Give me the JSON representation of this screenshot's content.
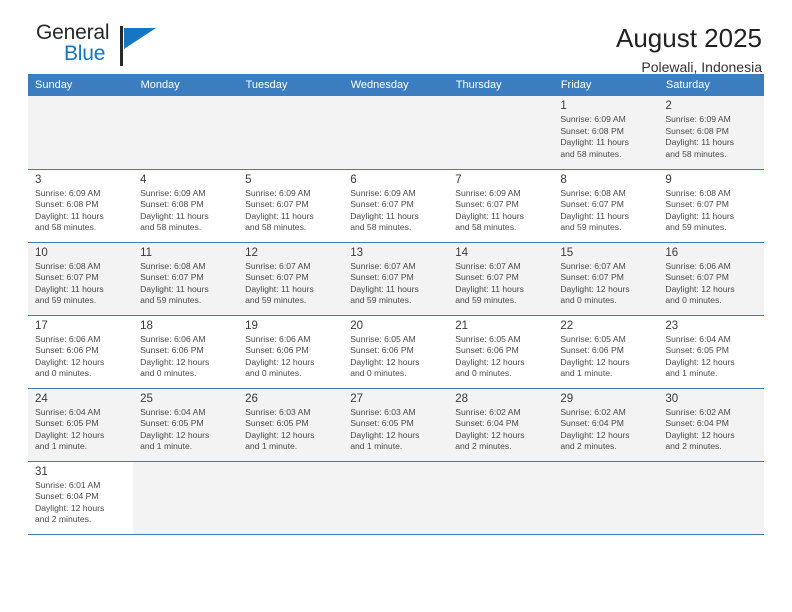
{
  "logo": {
    "word_top": "General",
    "word_bottom": "Blue",
    "triangle_color": "#1577c4",
    "icon": "general-blue-logo"
  },
  "header": {
    "title": "August 2025",
    "location": "Polewali, Indonesia"
  },
  "colors": {
    "header_row": "#3b7dbf",
    "shade_row": "#f3f3f3",
    "text": "#4a4a4a",
    "accent": "#1577c4"
  },
  "calendar": {
    "weekday_headers": [
      "Sunday",
      "Monday",
      "Tuesday",
      "Wednesday",
      "Thursday",
      "Friday",
      "Saturday"
    ],
    "labels": {
      "sunrise": "Sunrise:",
      "sunset": "Sunset:",
      "daylight": "Daylight:"
    },
    "weeks": [
      [
        {
          "day": "",
          "detail": ""
        },
        {
          "day": "",
          "detail": ""
        },
        {
          "day": "",
          "detail": ""
        },
        {
          "day": "",
          "detail": ""
        },
        {
          "day": "",
          "detail": ""
        },
        {
          "day": "1",
          "detail": "Sunrise: 6:09 AM\nSunset: 6:08 PM\nDaylight: 11 hours\nand 58 minutes."
        },
        {
          "day": "2",
          "detail": "Sunrise: 6:09 AM\nSunset: 6:08 PM\nDaylight: 11 hours\nand 58 minutes."
        }
      ],
      [
        {
          "day": "3",
          "detail": "Sunrise: 6:09 AM\nSunset: 6:08 PM\nDaylight: 11 hours\nand 58 minutes."
        },
        {
          "day": "4",
          "detail": "Sunrise: 6:09 AM\nSunset: 6:08 PM\nDaylight: 11 hours\nand 58 minutes."
        },
        {
          "day": "5",
          "detail": "Sunrise: 6:09 AM\nSunset: 6:07 PM\nDaylight: 11 hours\nand 58 minutes."
        },
        {
          "day": "6",
          "detail": "Sunrise: 6:09 AM\nSunset: 6:07 PM\nDaylight: 11 hours\nand 58 minutes."
        },
        {
          "day": "7",
          "detail": "Sunrise: 6:09 AM\nSunset: 6:07 PM\nDaylight: 11 hours\nand 58 minutes."
        },
        {
          "day": "8",
          "detail": "Sunrise: 6:08 AM\nSunset: 6:07 PM\nDaylight: 11 hours\nand 59 minutes."
        },
        {
          "day": "9",
          "detail": "Sunrise: 6:08 AM\nSunset: 6:07 PM\nDaylight: 11 hours\nand 59 minutes."
        }
      ],
      [
        {
          "day": "10",
          "detail": "Sunrise: 6:08 AM\nSunset: 6:07 PM\nDaylight: 11 hours\nand 59 minutes."
        },
        {
          "day": "11",
          "detail": "Sunrise: 6:08 AM\nSunset: 6:07 PM\nDaylight: 11 hours\nand 59 minutes."
        },
        {
          "day": "12",
          "detail": "Sunrise: 6:07 AM\nSunset: 6:07 PM\nDaylight: 11 hours\nand 59 minutes."
        },
        {
          "day": "13",
          "detail": "Sunrise: 6:07 AM\nSunset: 6:07 PM\nDaylight: 11 hours\nand 59 minutes."
        },
        {
          "day": "14",
          "detail": "Sunrise: 6:07 AM\nSunset: 6:07 PM\nDaylight: 11 hours\nand 59 minutes."
        },
        {
          "day": "15",
          "detail": "Sunrise: 6:07 AM\nSunset: 6:07 PM\nDaylight: 12 hours\nand 0 minutes."
        },
        {
          "day": "16",
          "detail": "Sunrise: 6:06 AM\nSunset: 6:07 PM\nDaylight: 12 hours\nand 0 minutes."
        }
      ],
      [
        {
          "day": "17",
          "detail": "Sunrise: 6:06 AM\nSunset: 6:06 PM\nDaylight: 12 hours\nand 0 minutes."
        },
        {
          "day": "18",
          "detail": "Sunrise: 6:06 AM\nSunset: 6:06 PM\nDaylight: 12 hours\nand 0 minutes."
        },
        {
          "day": "19",
          "detail": "Sunrise: 6:06 AM\nSunset: 6:06 PM\nDaylight: 12 hours\nand 0 minutes."
        },
        {
          "day": "20",
          "detail": "Sunrise: 6:05 AM\nSunset: 6:06 PM\nDaylight: 12 hours\nand 0 minutes."
        },
        {
          "day": "21",
          "detail": "Sunrise: 6:05 AM\nSunset: 6:06 PM\nDaylight: 12 hours\nand 0 minutes."
        },
        {
          "day": "22",
          "detail": "Sunrise: 6:05 AM\nSunset: 6:06 PM\nDaylight: 12 hours\nand 1 minute."
        },
        {
          "day": "23",
          "detail": "Sunrise: 6:04 AM\nSunset: 6:05 PM\nDaylight: 12 hours\nand 1 minute."
        }
      ],
      [
        {
          "day": "24",
          "detail": "Sunrise: 6:04 AM\nSunset: 6:05 PM\nDaylight: 12 hours\nand 1 minute."
        },
        {
          "day": "25",
          "detail": "Sunrise: 6:04 AM\nSunset: 6:05 PM\nDaylight: 12 hours\nand 1 minute."
        },
        {
          "day": "26",
          "detail": "Sunrise: 6:03 AM\nSunset: 6:05 PM\nDaylight: 12 hours\nand 1 minute."
        },
        {
          "day": "27",
          "detail": "Sunrise: 6:03 AM\nSunset: 6:05 PM\nDaylight: 12 hours\nand 1 minute."
        },
        {
          "day": "28",
          "detail": "Sunrise: 6:02 AM\nSunset: 6:04 PM\nDaylight: 12 hours\nand 2 minutes."
        },
        {
          "day": "29",
          "detail": "Sunrise: 6:02 AM\nSunset: 6:04 PM\nDaylight: 12 hours\nand 2 minutes."
        },
        {
          "day": "30",
          "detail": "Sunrise: 6:02 AM\nSunset: 6:04 PM\nDaylight: 12 hours\nand 2 minutes."
        }
      ],
      [
        {
          "day": "31",
          "detail": "Sunrise: 6:01 AM\nSunset: 6:04 PM\nDaylight: 12 hours\nand 2 minutes."
        },
        {
          "day": "",
          "detail": ""
        },
        {
          "day": "",
          "detail": ""
        },
        {
          "day": "",
          "detail": ""
        },
        {
          "day": "",
          "detail": ""
        },
        {
          "day": "",
          "detail": ""
        },
        {
          "day": "",
          "detail": ""
        }
      ]
    ]
  }
}
